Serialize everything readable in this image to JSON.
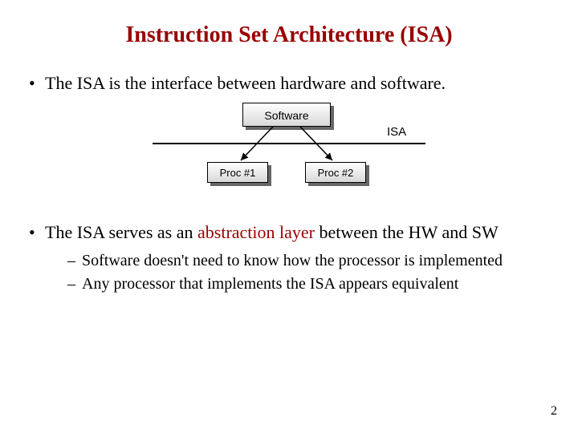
{
  "title": "Instruction Set Architecture (ISA)",
  "bullets": {
    "b1": "The ISA is the interface between hardware and software.",
    "b2_pre": "The ISA serves as an ",
    "b2_hl": "abstraction layer",
    "b2_post": " between the HW and SW",
    "sub1": "Software doesn't need to know how the processor is implemented",
    "sub2": "Any processor that implements the ISA appears equivalent"
  },
  "diagram": {
    "software": "Software",
    "proc1": "Proc #1",
    "proc2": "Proc #2",
    "isa": "ISA"
  },
  "page": "2"
}
